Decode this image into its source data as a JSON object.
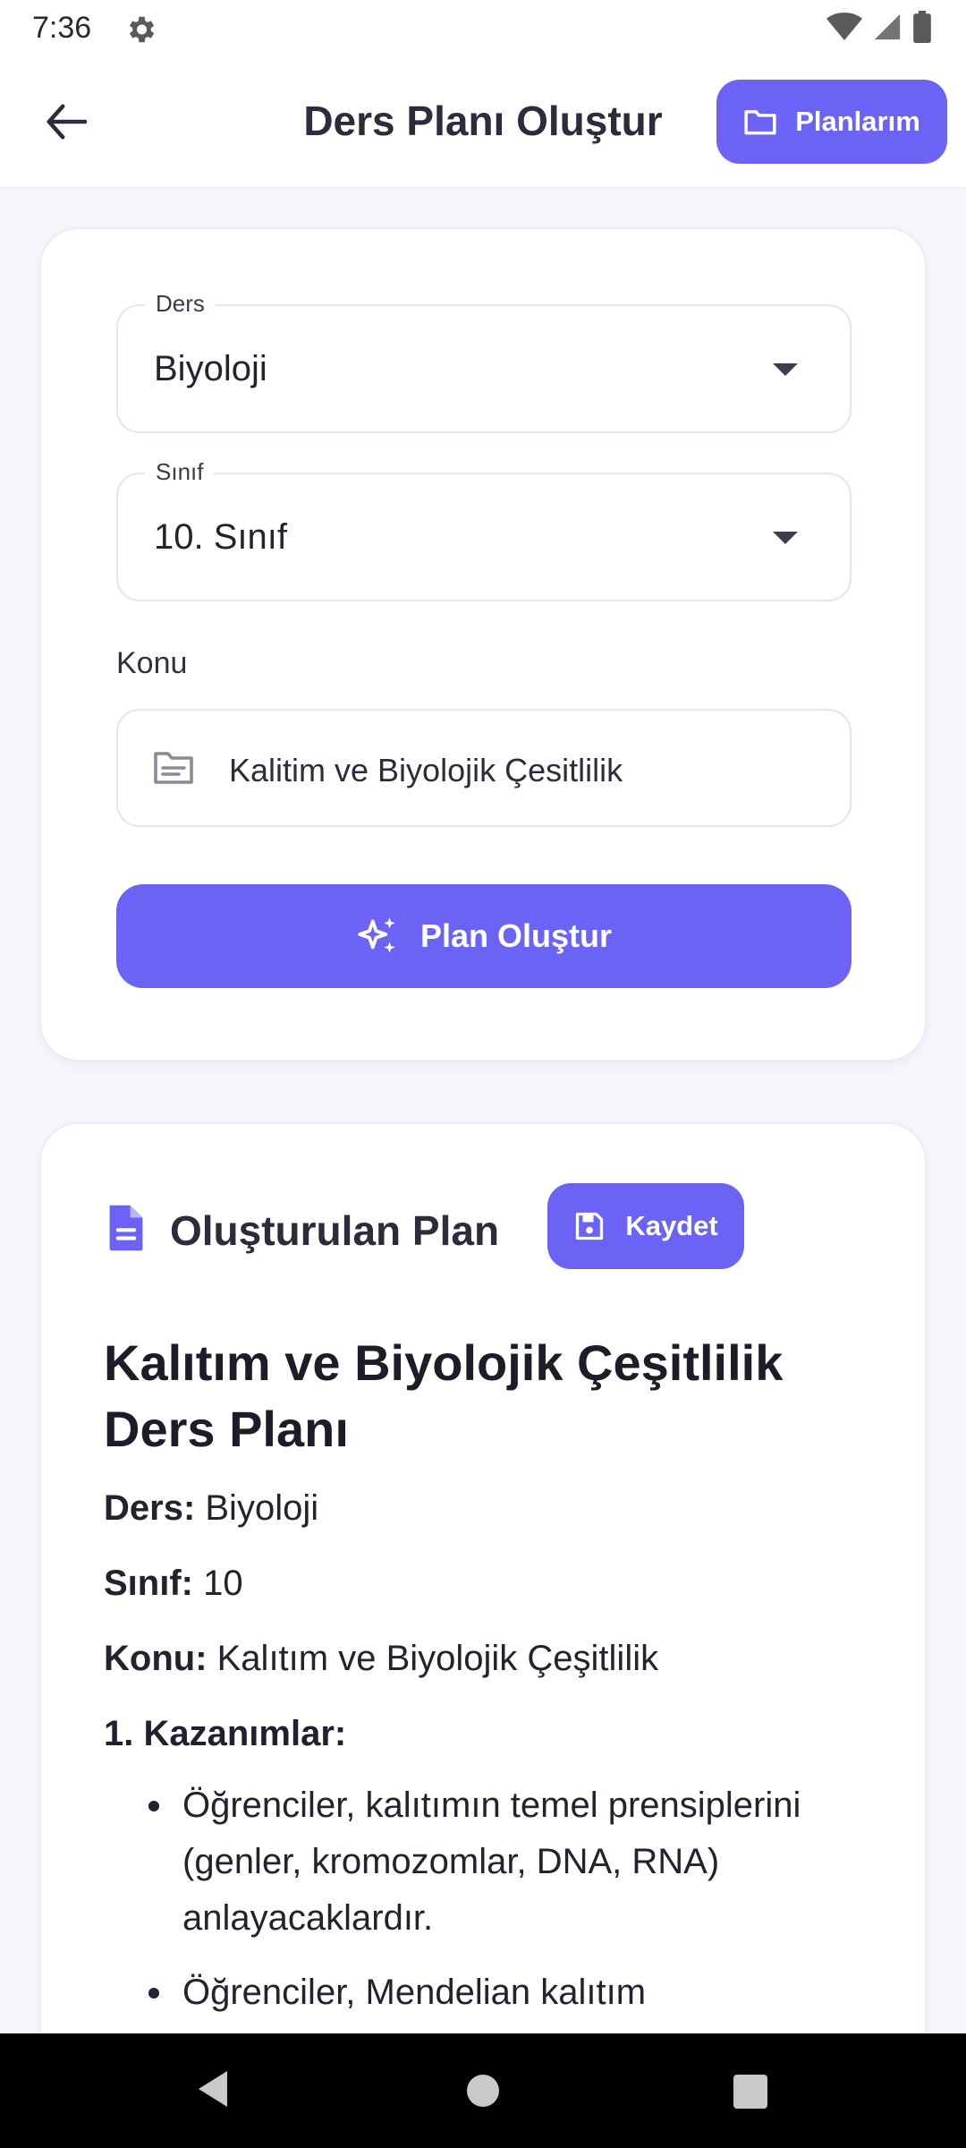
{
  "status_bar": {
    "time": "7:36"
  },
  "app_bar": {
    "title": "Ders Planı Oluştur",
    "plans_button": "Planlarım"
  },
  "form": {
    "ders_label": "Ders",
    "ders_value": "Biyoloji",
    "sinif_label": "Sınıf",
    "sinif_value": "10. Sınıf",
    "konu_label": "Konu",
    "konu_value": "Kalitim ve Biyolojik Çesitlilik",
    "create_button": "Plan Oluştur"
  },
  "plan": {
    "header": "Oluşturulan Plan",
    "save_button": "Kaydet",
    "title": "Kalıtım ve Biyolojik Çeşitlilik Ders Planı",
    "ders_key": "Ders:",
    "ders_val": " Biyoloji",
    "sinif_key": "Sınıf:",
    "sinif_val": " 10",
    "konu_key": "Konu:",
    "konu_val": " Kalıtım ve Biyolojik Çeşitlilik",
    "section1": "1. Kazanımlar:",
    "bullets": [
      "Öğrenciler, kalıtımın temel prensiplerini (genler, kromozomlar, DNA, RNA) anlayacaklardır.",
      "Öğrenciler, Mendelian kalıtım"
    ]
  },
  "colors": {
    "accent": "#6a63f6",
    "background": "#f5f6fb"
  }
}
